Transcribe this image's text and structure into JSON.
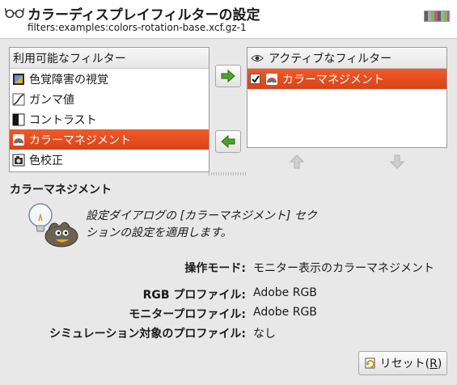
{
  "dialog": {
    "title": "カラーディスプレイフィルターの設定",
    "subtitle": "filters:examples:colors-rotation-base.xcf.gz-1",
    "header_icon": "glasses-icon"
  },
  "available": {
    "header": "利用可能なフィルター",
    "items": [
      {
        "label": "色覚障害の視覚",
        "icon": "color-deficient-icon",
        "selected": false
      },
      {
        "label": "ガンマ値",
        "icon": "gamma-curve-icon",
        "selected": false
      },
      {
        "label": "コントラスト",
        "icon": "contrast-icon",
        "selected": false
      },
      {
        "label": "カラーマネジメント",
        "icon": "color-management-icon",
        "selected": true
      },
      {
        "label": "色校正",
        "icon": "proof-icon",
        "selected": false
      }
    ]
  },
  "active": {
    "header": "アクティブなフィルター",
    "header_icon": "eye-icon",
    "items": [
      {
        "label": "カラーマネジメント",
        "icon": "color-management-icon",
        "checked": true,
        "selected": true
      }
    ]
  },
  "buttons": {
    "add": "add-arrow-right-icon",
    "remove": "remove-arrow-left-icon",
    "up": "move-up-icon",
    "down": "move-down-icon",
    "reset_label": "リセット(",
    "reset_mnemonic": "R",
    "reset_close": ")"
  },
  "details": {
    "title": "カラーマネジメント",
    "description": "設定ダイアログの [カラーマネジメント] セクションの設定を適用します。",
    "properties": [
      {
        "label": "操作モード:",
        "value": "モニター表示のカラーマネジメント"
      },
      {
        "label": "RGB プロファイル:",
        "value": "Adobe RGB"
      },
      {
        "label": "モニタープロファイル:",
        "value": "Adobe RGB"
      },
      {
        "label": "シミュレーション対象のプロファイル:",
        "value": "なし"
      }
    ]
  },
  "colors": {
    "selection": "#e84c20",
    "arrow_green": "#3f9a1f"
  }
}
